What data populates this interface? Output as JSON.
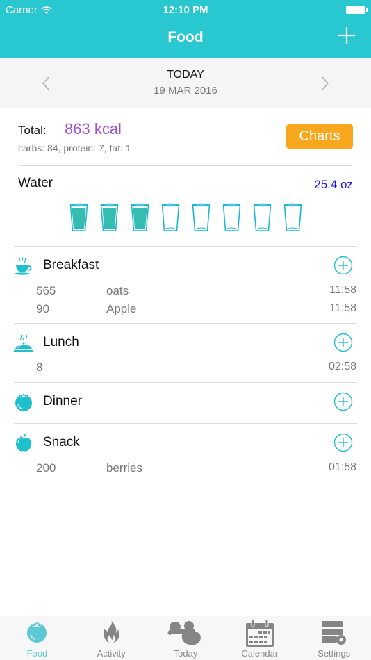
{
  "status_bar": {
    "carrier": "Carrier",
    "time": "12:10 PM"
  },
  "nav": {
    "title": "Food",
    "add_icon": "plus-icon"
  },
  "date_nav": {
    "day_label": "TODAY",
    "date": "19 MAR 2016",
    "prev_icon": "chevron-left-icon",
    "next_icon": "chevron-right-icon"
  },
  "summary": {
    "total_label": "Total:",
    "kcal": "863 kcal",
    "macros": "carbs: 84, protein: 7, fat: 1",
    "charts_button": "Charts"
  },
  "water": {
    "label": "Water",
    "amount": "25.4 oz",
    "glasses_total": 8,
    "glasses_filled": 3
  },
  "meals": [
    {
      "name": "Breakfast",
      "icon": "coffee-cup-icon",
      "entries": [
        {
          "calories": "565",
          "food": "oats",
          "time": "11:58"
        },
        {
          "calories": "90",
          "food": "Apple",
          "time": "11:58"
        }
      ]
    },
    {
      "name": "Lunch",
      "icon": "cloche-icon",
      "entries": [
        {
          "calories": "8",
          "food": "",
          "time": "02:58"
        }
      ]
    },
    {
      "name": "Dinner",
      "icon": "tomato-icon",
      "entries": []
    },
    {
      "name": "Snack",
      "icon": "apple-icon",
      "entries": [
        {
          "calories": "200",
          "food": "berries",
          "time": "01:58"
        }
      ]
    }
  ],
  "tabs": [
    {
      "label": "Food",
      "icon": "tomato-icon",
      "active": true
    },
    {
      "label": "Activity",
      "icon": "flame-icon",
      "active": false
    },
    {
      "label": "Today",
      "icon": "dumbbell-icon",
      "active": false
    },
    {
      "label": "Calendar",
      "icon": "calendar-icon",
      "active": false
    },
    {
      "label": "Settings",
      "icon": "settings-icon",
      "active": false
    }
  ],
  "colors": {
    "accent": "#29c8d0",
    "kcal": "#a24fcf",
    "charts": "#f7a81d",
    "water_amount": "#1a1ae6",
    "water_fill": "#35bdb2"
  }
}
